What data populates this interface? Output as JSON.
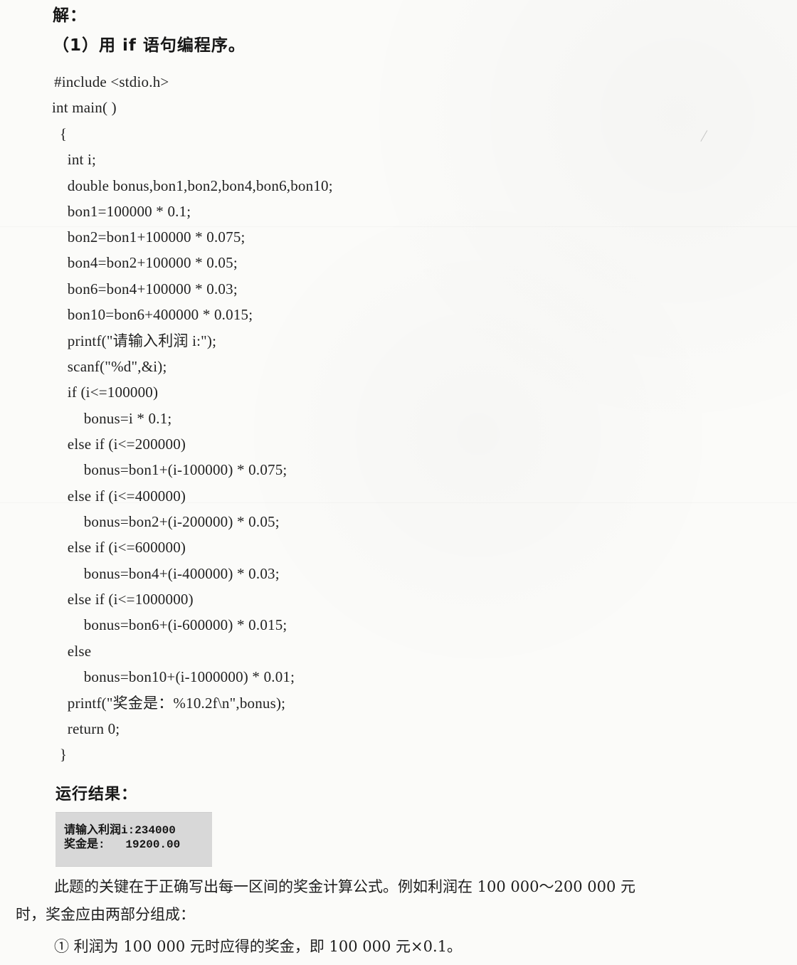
{
  "document": {
    "solve_heading": "解：",
    "method_heading": "（1）用 if 语句编程序。",
    "code_lines": [
      "#include <stdio.h>",
      "int main( )",
      "  {",
      "    int i;",
      "    double bonus,bon1,bon2,bon4,bon6,bon10;",
      "    bon1=100000 * 0.1;",
      "    bon2=bon1+100000 * 0.075;",
      "    bon4=bon2+100000 * 0.05;",
      "    bon6=bon4+100000 * 0.03;",
      "    bon10=bon6+400000 * 0.015;",
      "    printf(\"请输入利润 i:\");",
      "    scanf(\"%d\",&i);",
      "    if (i<=100000)",
      "      bonus=i * 0.1;",
      "    else if (i<=200000)",
      "      bonus=bon1+(i-100000) * 0.075;",
      "    else if (i<=400000)",
      "      bonus=bon2+(i-200000) * 0.05;",
      "    else if (i<=600000)",
      "      bonus=bon4+(i-400000) * 0.03;",
      "    else if (i<=1000000)",
      "      bonus=bon6+(i-600000) * 0.015;",
      "    else",
      "      bonus=bon10+(i-1000000) * 0.01;",
      "    printf(\"奖金是：%10.2f\\n\",bonus);",
      "    return 0;",
      "  }"
    ],
    "result_heading": "运行结果：",
    "console_output": [
      "请输入利润i:234000",
      "奖金是:   19200.00"
    ],
    "paragraphs": [
      "此题的关键在于正确写出每一区间的奖金计算公式。例如利润在 100 000～200 000 元",
      "时，奖金应由两部分组成：",
      "① 利润为 100 000 元时应得的奖金，即 100 000 元×0.1。"
    ]
  },
  "colors": {
    "paper": "#fbfbf9",
    "text": "#1e1e1e",
    "console_background": "#d8d8d8"
  }
}
